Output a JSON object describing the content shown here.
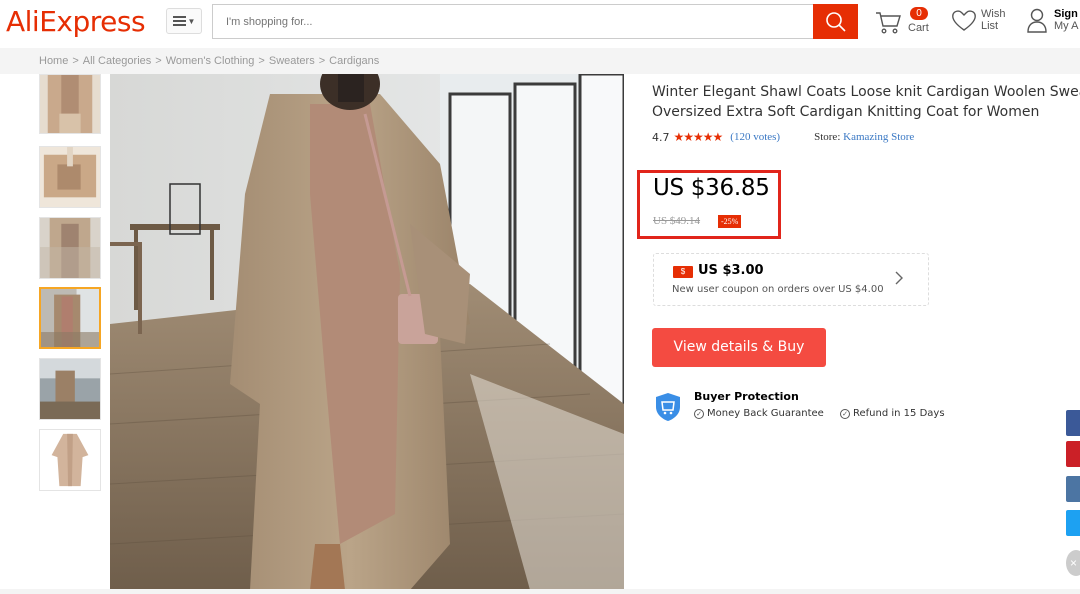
{
  "header": {
    "logo": "AliExpress",
    "search_placeholder": "I'm shopping for...",
    "cart": {
      "count": "0",
      "label": "Cart"
    },
    "wishlist": {
      "line1": "Wish",
      "line2": "List"
    },
    "account": {
      "line1": "Sign",
      "line2": "My A"
    }
  },
  "breadcrumb": [
    "Home",
    "All Categories",
    "Women's Clothing",
    "Sweaters",
    "Cardigans"
  ],
  "breadcrumb_sep": ">",
  "product": {
    "title_line1": "Winter Elegant Shawl Coats Loose knit Cardigan Woolen Sweater",
    "title_line2": "Oversized Extra Soft Cardigan Knitting Coat for Women",
    "rating": "4.7",
    "stars": "★★★★★",
    "votes": "(120 votes)",
    "store_label": "Store:",
    "store_name": "Kamazing Store",
    "price": "US $36.85",
    "old_price": "US $49.14",
    "discount": "-25%",
    "coupon": {
      "icon_text": "$",
      "amount": "US $3.00",
      "desc": "New user coupon on orders over US $4.00"
    },
    "buy_label": "View details & Buy",
    "protection": {
      "title": "Buyer Protection",
      "items": [
        "Money Back Guarantee",
        "Refund in 15 Days"
      ]
    }
  },
  "thumbnails": [
    "thumb-1",
    "thumb-2",
    "thumb-3",
    "thumb-4",
    "thumb-5",
    "thumb-6"
  ],
  "active_thumbnail_index": 3,
  "social": [
    {
      "name": "facebook",
      "color": "#3b5998"
    },
    {
      "name": "pinterest",
      "color": "#cb2027"
    },
    {
      "name": "vk",
      "color": "#4c75a3"
    },
    {
      "name": "twitter",
      "color": "#1da1f2"
    }
  ],
  "colors": {
    "brand": "#e62e04",
    "buy_button": "#f44b41",
    "highlight_box": "#e1251b",
    "link": "#3a78c4"
  }
}
